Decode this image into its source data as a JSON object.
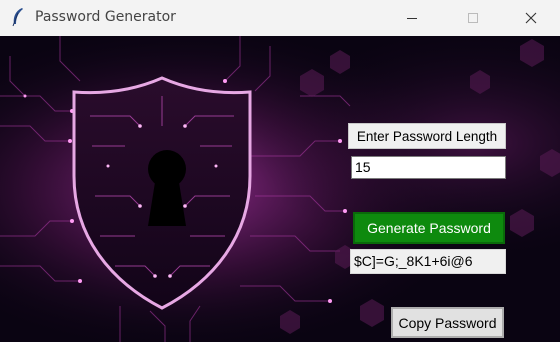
{
  "window": {
    "title": "Password Generator",
    "icon": "feather-icon",
    "controls": [
      "minimize-icon",
      "maximize-icon",
      "close-icon"
    ]
  },
  "form": {
    "length_label": "Enter Password Length",
    "length_value": "15",
    "generate_label": "Generate Password",
    "generated_password": "$C]=G;_8K1+6i@6",
    "copy_label": "Copy Password"
  },
  "background": {
    "image": "shield with keyhole on purple circuit board",
    "accent": "#d04cc8",
    "base": "#0a0412"
  },
  "colors": {
    "generate_button": "#0e8a0e",
    "copy_button": "#e1e1e1"
  }
}
